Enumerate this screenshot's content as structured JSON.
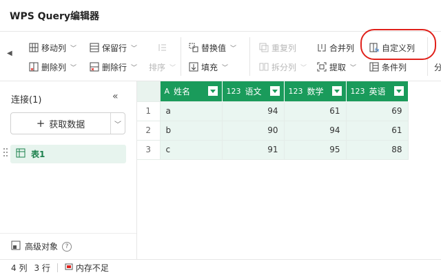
{
  "app": {
    "title": "WPS Query编辑器"
  },
  "ribbon": {
    "move_column": "移动列",
    "keep_rows": "保留行",
    "sort": "排序",
    "replace_values": "替换值",
    "remove_duplicates": "重复列",
    "merge": "合并列",
    "custom_column": "自定义列",
    "delete_column": "删除列",
    "delete_rows": "删除行",
    "fill": "填充",
    "split_column": "拆分列",
    "extract": "提取",
    "conditional_column": "条件列",
    "overflow": "分"
  },
  "sidebar": {
    "connections_title": "连接(1)",
    "collapse_symbol": "«",
    "get_data": "获取数据",
    "tables": [
      {
        "label": "表1"
      }
    ],
    "advanced_objects": "高级对象"
  },
  "grid": {
    "columns": [
      {
        "type": "A",
        "name": "姓名"
      },
      {
        "type": "123",
        "name": "语文"
      },
      {
        "type": "123",
        "name": "数学"
      },
      {
        "type": "123",
        "name": "英语"
      }
    ],
    "rows": [
      {
        "num": "1",
        "name": "a",
        "chinese": "94",
        "math": "61",
        "english": "69"
      },
      {
        "num": "2",
        "name": "b",
        "chinese": "90",
        "math": "94",
        "english": "61"
      },
      {
        "num": "3",
        "name": "c",
        "chinese": "91",
        "math": "95",
        "english": "88"
      }
    ]
  },
  "status": {
    "columns": "4 列",
    "rows": "3 行",
    "memory": "内存不足"
  },
  "colors": {
    "accent": "#1a9b5b",
    "highlight": "#e0201a"
  }
}
